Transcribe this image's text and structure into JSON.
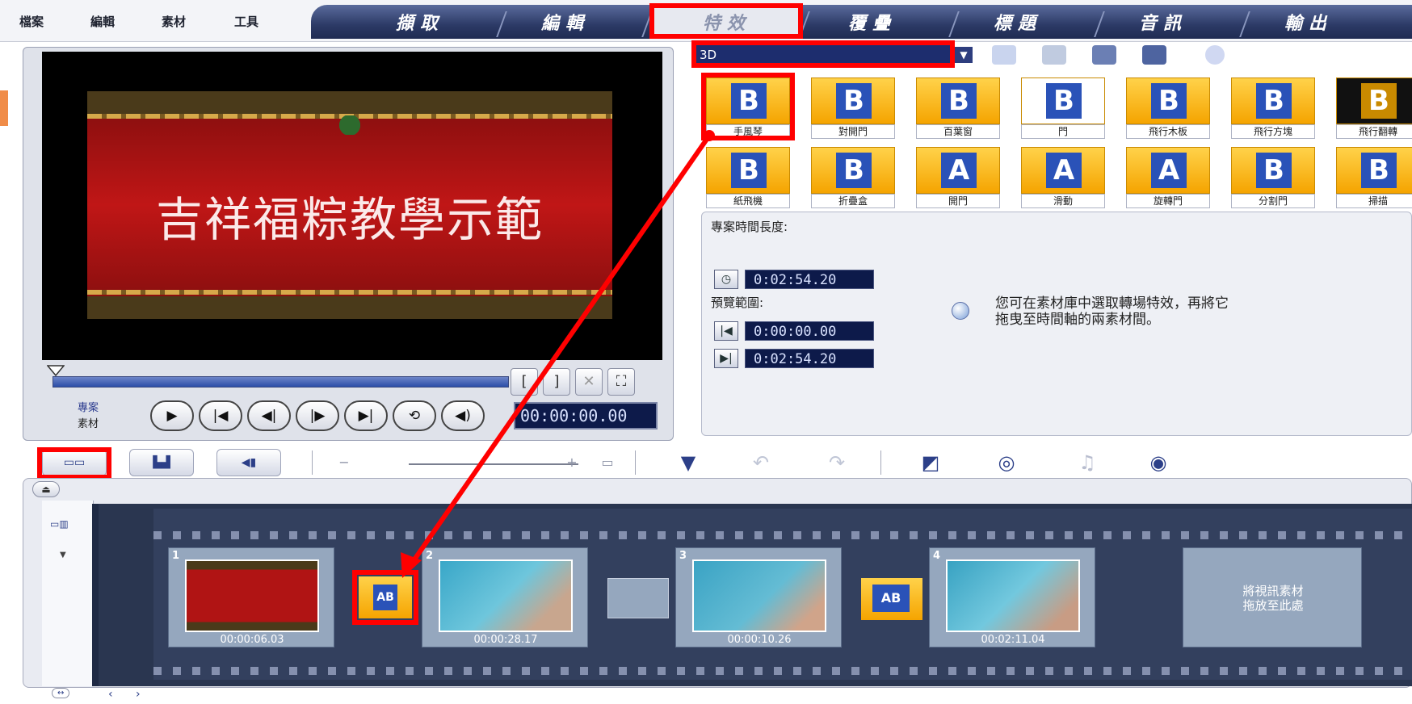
{
  "menu": {
    "file": "檔案",
    "edit": "編輯",
    "clip": "素材",
    "tools": "工具"
  },
  "tabs": [
    {
      "label": "擷取"
    },
    {
      "label": "編輯"
    },
    {
      "label": "特效",
      "active": true
    },
    {
      "label": "覆疊"
    },
    {
      "label": "標題"
    },
    {
      "label": "音訊"
    },
    {
      "label": "輸出"
    }
  ],
  "preview": {
    "video_title": "吉祥福粽教學示範",
    "mode_project": "專案",
    "mode_clip": "素材",
    "timecode": "00:00:00.00",
    "play_buttons": [
      "▶",
      "|◀",
      "◀|",
      "|▶",
      "▶|",
      "⟲",
      "◀)"
    ]
  },
  "library": {
    "category": "3D",
    "effects_row1": [
      "手風琴",
      "對開門",
      "百葉窗",
      "門",
      "飛行木板",
      "飛行方塊",
      "飛行翻轉"
    ],
    "effects_row2": [
      "紙飛機",
      "折疊盒",
      "開門",
      "滑動",
      "旋轉門",
      "分割門",
      "掃描"
    ]
  },
  "info": {
    "project_duration_label": "專案時間長度:",
    "project_duration": "0:02:54.20",
    "preview_range_label": "預覽範圍:",
    "range_start": "0:00:00.00",
    "range_end": "0:02:54.20",
    "hint_line1": "您可在素材庫中選取轉場特效，再將它",
    "hint_line2": "拖曳至時間軸的兩素材間。"
  },
  "timeline": {
    "clips": [
      {
        "num": "1",
        "duration": "00:00:06.03"
      },
      {
        "num": "2",
        "duration": "00:00:28.17"
      },
      {
        "num": "3",
        "duration": "00:00:10.26"
      },
      {
        "num": "4",
        "duration": "00:02:11.04"
      }
    ],
    "drop_text_line1": "將視訊素材",
    "drop_text_line2": "拖放至此處"
  },
  "colors": {
    "highlight": "#ff0000",
    "tab_bar": "#2c3a66",
    "timecode_bg": "#0d1a4a",
    "thumb_gold": "#f5a400",
    "accent_orange": "#f08c48"
  }
}
